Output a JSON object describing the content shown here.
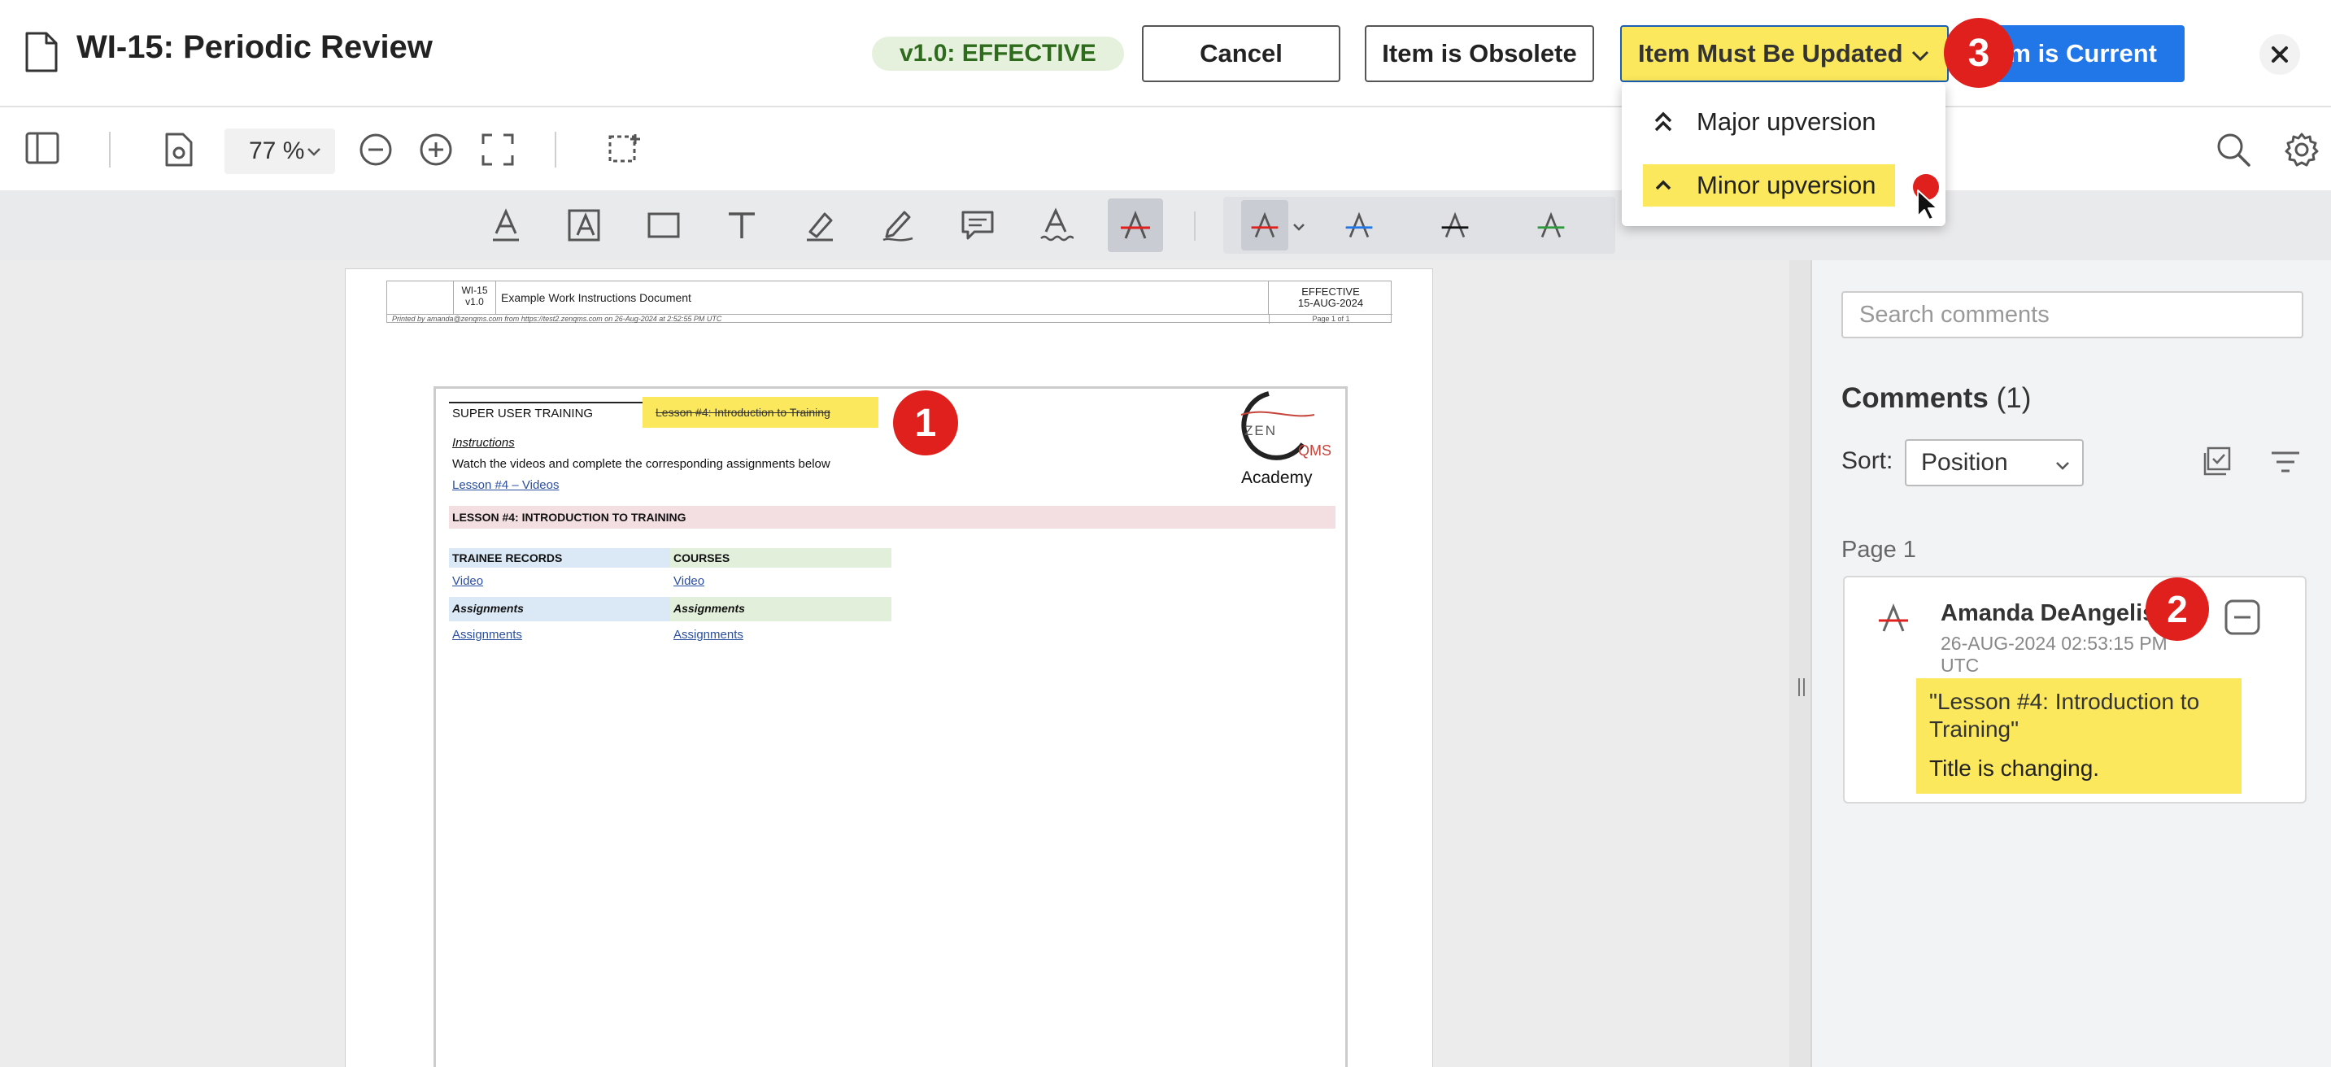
{
  "header": {
    "title": "WI-15: Periodic Review",
    "status_badge": "v1.0: EFFECTIVE",
    "cancel_label": "Cancel",
    "obsolete_label": "Item is Obsolete",
    "update_label": "Item Must Be Updated",
    "current_label": "tem is Current"
  },
  "markers": [
    "1",
    "2",
    "3"
  ],
  "toolbar": {
    "zoom": "77 %"
  },
  "dropdown": {
    "items": [
      {
        "label": "Major upversion",
        "icon": "double-chevron-up-icon"
      },
      {
        "label": "Minor upversion",
        "icon": "chevron-up-icon",
        "highlighted": true
      }
    ]
  },
  "document": {
    "header": {
      "doc_id": "WI-15",
      "version": "v1.0",
      "doc_title": "Example Work Instructions Document",
      "status": "EFFECTIVE",
      "date": "15-AUG-2024",
      "printed_by": "Printed by amanda@zenqms.com from https://test2.zenqms.com on 26-Aug-2024 at 2:52:55 PM UTC",
      "page": "Page 1 of 1"
    },
    "content": {
      "super_user": "SUPER USER TRAINING",
      "lesson_highlight": "Lesson #4: Introduction to Training",
      "instructions": "Instructions",
      "watch_text": "Watch the videos and complete the corresponding assignments below",
      "videos_link": "Lesson #4 – Videos",
      "lesson_heading": "LESSON #4: INTRODUCTION TO TRAINING",
      "col1_header": "TRAINEE RECORDS",
      "col2_header": "COURSES",
      "video1": "Video",
      "video2": "Video",
      "assign_h1": "Assignments",
      "assign_h2": "Assignments",
      "assign1": "Assignments",
      "assign2": "Assignments",
      "logo_zen": "ZEN",
      "logo_qms": "QMS",
      "logo_academy": "Academy"
    }
  },
  "comments": {
    "search_placeholder": "Search comments",
    "heading": "Comments",
    "count": "(1)",
    "sort_label": "Sort:",
    "sort_value": "Position",
    "page_label": "Page 1",
    "items": [
      {
        "author": "Amanda DeAngelis",
        "date": "26-AUG-2024 02:53:15 PM UTC",
        "quote": "\"Lesson #4: Introduction to Training\"",
        "note": "Title is changing."
      }
    ]
  },
  "colors": {
    "highlight": "#fbe85c",
    "primary": "#2176e8",
    "marker": "#e0201c",
    "badge_bg": "#e5f1dd",
    "badge_text": "#2e6b1c"
  }
}
